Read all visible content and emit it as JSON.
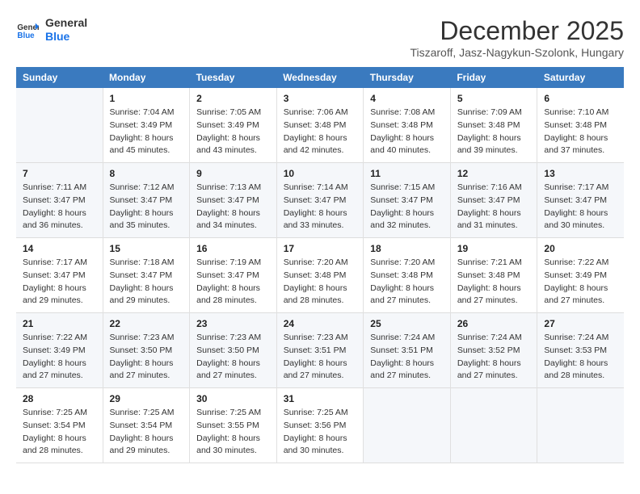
{
  "logo": {
    "line1": "General",
    "line2": "Blue"
  },
  "title": "December 2025",
  "subtitle": "Tiszaroff, Jasz-Nagykun-Szolonk, Hungary",
  "header": {
    "days": [
      "Sunday",
      "Monday",
      "Tuesday",
      "Wednesday",
      "Thursday",
      "Friday",
      "Saturday"
    ]
  },
  "weeks": [
    [
      {
        "day": "",
        "info": ""
      },
      {
        "day": "1",
        "info": "Sunrise: 7:04 AM\nSunset: 3:49 PM\nDaylight: 8 hours\nand 45 minutes."
      },
      {
        "day": "2",
        "info": "Sunrise: 7:05 AM\nSunset: 3:49 PM\nDaylight: 8 hours\nand 43 minutes."
      },
      {
        "day": "3",
        "info": "Sunrise: 7:06 AM\nSunset: 3:48 PM\nDaylight: 8 hours\nand 42 minutes."
      },
      {
        "day": "4",
        "info": "Sunrise: 7:08 AM\nSunset: 3:48 PM\nDaylight: 8 hours\nand 40 minutes."
      },
      {
        "day": "5",
        "info": "Sunrise: 7:09 AM\nSunset: 3:48 PM\nDaylight: 8 hours\nand 39 minutes."
      },
      {
        "day": "6",
        "info": "Sunrise: 7:10 AM\nSunset: 3:48 PM\nDaylight: 8 hours\nand 37 minutes."
      }
    ],
    [
      {
        "day": "7",
        "info": "Sunrise: 7:11 AM\nSunset: 3:47 PM\nDaylight: 8 hours\nand 36 minutes."
      },
      {
        "day": "8",
        "info": "Sunrise: 7:12 AM\nSunset: 3:47 PM\nDaylight: 8 hours\nand 35 minutes."
      },
      {
        "day": "9",
        "info": "Sunrise: 7:13 AM\nSunset: 3:47 PM\nDaylight: 8 hours\nand 34 minutes."
      },
      {
        "day": "10",
        "info": "Sunrise: 7:14 AM\nSunset: 3:47 PM\nDaylight: 8 hours\nand 33 minutes."
      },
      {
        "day": "11",
        "info": "Sunrise: 7:15 AM\nSunset: 3:47 PM\nDaylight: 8 hours\nand 32 minutes."
      },
      {
        "day": "12",
        "info": "Sunrise: 7:16 AM\nSunset: 3:47 PM\nDaylight: 8 hours\nand 31 minutes."
      },
      {
        "day": "13",
        "info": "Sunrise: 7:17 AM\nSunset: 3:47 PM\nDaylight: 8 hours\nand 30 minutes."
      }
    ],
    [
      {
        "day": "14",
        "info": "Sunrise: 7:17 AM\nSunset: 3:47 PM\nDaylight: 8 hours\nand 29 minutes."
      },
      {
        "day": "15",
        "info": "Sunrise: 7:18 AM\nSunset: 3:47 PM\nDaylight: 8 hours\nand 29 minutes."
      },
      {
        "day": "16",
        "info": "Sunrise: 7:19 AM\nSunset: 3:47 PM\nDaylight: 8 hours\nand 28 minutes."
      },
      {
        "day": "17",
        "info": "Sunrise: 7:20 AM\nSunset: 3:48 PM\nDaylight: 8 hours\nand 28 minutes."
      },
      {
        "day": "18",
        "info": "Sunrise: 7:20 AM\nSunset: 3:48 PM\nDaylight: 8 hours\nand 27 minutes."
      },
      {
        "day": "19",
        "info": "Sunrise: 7:21 AM\nSunset: 3:48 PM\nDaylight: 8 hours\nand 27 minutes."
      },
      {
        "day": "20",
        "info": "Sunrise: 7:22 AM\nSunset: 3:49 PM\nDaylight: 8 hours\nand 27 minutes."
      }
    ],
    [
      {
        "day": "21",
        "info": "Sunrise: 7:22 AM\nSunset: 3:49 PM\nDaylight: 8 hours\nand 27 minutes."
      },
      {
        "day": "22",
        "info": "Sunrise: 7:23 AM\nSunset: 3:50 PM\nDaylight: 8 hours\nand 27 minutes."
      },
      {
        "day": "23",
        "info": "Sunrise: 7:23 AM\nSunset: 3:50 PM\nDaylight: 8 hours\nand 27 minutes."
      },
      {
        "day": "24",
        "info": "Sunrise: 7:23 AM\nSunset: 3:51 PM\nDaylight: 8 hours\nand 27 minutes."
      },
      {
        "day": "25",
        "info": "Sunrise: 7:24 AM\nSunset: 3:51 PM\nDaylight: 8 hours\nand 27 minutes."
      },
      {
        "day": "26",
        "info": "Sunrise: 7:24 AM\nSunset: 3:52 PM\nDaylight: 8 hours\nand 27 minutes."
      },
      {
        "day": "27",
        "info": "Sunrise: 7:24 AM\nSunset: 3:53 PM\nDaylight: 8 hours\nand 28 minutes."
      }
    ],
    [
      {
        "day": "28",
        "info": "Sunrise: 7:25 AM\nSunset: 3:54 PM\nDaylight: 8 hours\nand 28 minutes."
      },
      {
        "day": "29",
        "info": "Sunrise: 7:25 AM\nSunset: 3:54 PM\nDaylight: 8 hours\nand 29 minutes."
      },
      {
        "day": "30",
        "info": "Sunrise: 7:25 AM\nSunset: 3:55 PM\nDaylight: 8 hours\nand 30 minutes."
      },
      {
        "day": "31",
        "info": "Sunrise: 7:25 AM\nSunset: 3:56 PM\nDaylight: 8 hours\nand 30 minutes."
      },
      {
        "day": "",
        "info": ""
      },
      {
        "day": "",
        "info": ""
      },
      {
        "day": "",
        "info": ""
      }
    ]
  ]
}
